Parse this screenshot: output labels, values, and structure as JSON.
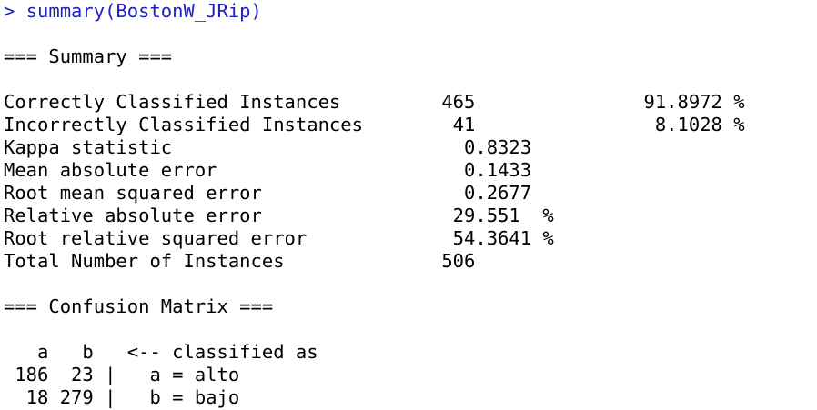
{
  "console": {
    "prompt": "> ",
    "command": "summary(BostonW_JRip)",
    "output_lines": [
      "",
      "=== Summary ===",
      "",
      "Correctly Classified Instances         465               91.8972 %",
      "Incorrectly Classified Instances        41                8.1028 %",
      "Kappa statistic                          0.8323",
      "Mean absolute error                      0.1433",
      "Root mean squared error                  0.2677",
      "Relative absolute error                 29.551  %",
      "Root relative squared error             54.3641 %",
      "Total Number of Instances              506     ",
      "",
      "=== Confusion Matrix ===",
      "",
      "   a   b   <-- classified as",
      " 186  23 |   a = alto",
      "  18 279 |   b = bajo"
    ]
  },
  "colors": {
    "command": "#1f20c6",
    "output": "#000000",
    "background": "#ffffff"
  }
}
